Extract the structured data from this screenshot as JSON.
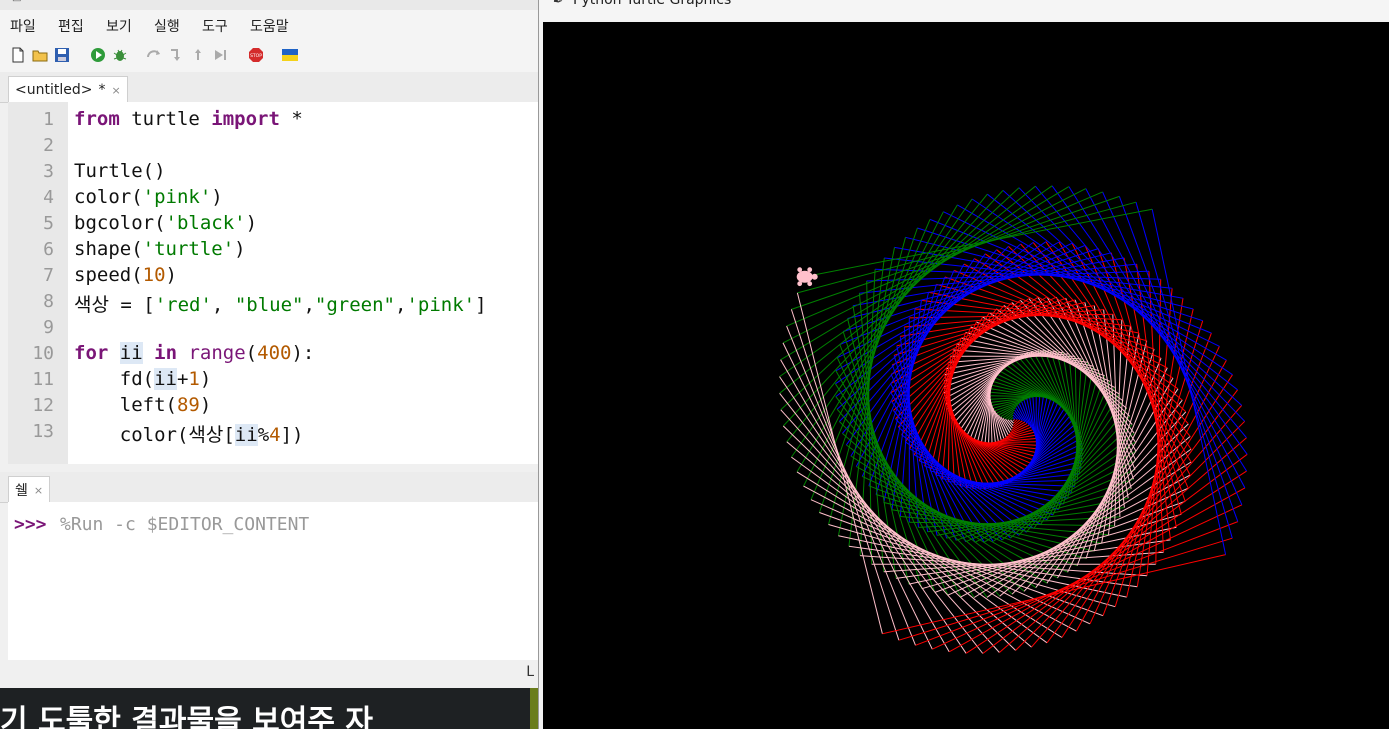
{
  "menu": {
    "file": "파일",
    "edit": "편집",
    "view": "보기",
    "run": "실행",
    "tools": "도구",
    "help": "도움말"
  },
  "editor_tab": {
    "label": "<untitled>",
    "modified": "*",
    "close": "×"
  },
  "line_numbers": [
    "1",
    "2",
    "3",
    "4",
    "5",
    "6",
    "7",
    "8",
    "9",
    "10",
    "11",
    "12",
    "13"
  ],
  "shell_tab": {
    "label": "쉘",
    "close": "×"
  },
  "shell": {
    "prompt": ">>>",
    "command": "%Run -c $EDITOR_CONTENT"
  },
  "status": {
    "right": "L"
  },
  "background_caption": "기 도툴한 결과물을 보여주 자",
  "turtle_window": {
    "title": "Python Turtle Graphics"
  },
  "code_tokens": {
    "l1": {
      "kw1": "from",
      "mod": " turtle ",
      "kw2": "import",
      "rest": " *"
    },
    "l3": "Turtle()",
    "l4": {
      "fn": "color(",
      "arg": "'pink'",
      "end": ")"
    },
    "l5": {
      "fn": "bgcolor(",
      "arg": "'black'",
      "end": ")"
    },
    "l6": {
      "fn": "shape(",
      "arg": "'turtle'",
      "end": ")"
    },
    "l7": {
      "fn": "speed(",
      "arg": "10",
      "end": ")"
    },
    "l8": {
      "var": "색상 = [",
      "a": "'red'",
      "s1": ", ",
      "b": "\"blue\"",
      "s2": ",",
      "c": "\"green\"",
      "s3": ",",
      "d": "'pink'",
      "end": "]"
    },
    "l10": {
      "kw1": "for",
      "sp1": " ",
      "var": "ii",
      "sp2": " ",
      "kw2": "in",
      "sp3": " ",
      "bi": "range",
      "p1": "(",
      "num": "400",
      "p2": "):"
    },
    "l11": {
      "ind": "    fd(",
      "var": "ii",
      "plus": "+",
      "num": "1",
      "end": ")"
    },
    "l12": {
      "ind": "    left(",
      "num": "89",
      "end": ")"
    },
    "l13": {
      "ind": "    color(색상[",
      "var": "ii",
      "pct": "%",
      "num": "4",
      "end": "])"
    }
  },
  "turtle": {
    "iterations": 400,
    "turn_deg": 89,
    "colors": [
      "red",
      "blue",
      "green",
      "pink"
    ],
    "pink_hex": "#ffc0cb",
    "red_hex": "#ff0000",
    "blue_hex": "#0000ff",
    "green_hex": "#008000",
    "background_hex": "#000000"
  }
}
